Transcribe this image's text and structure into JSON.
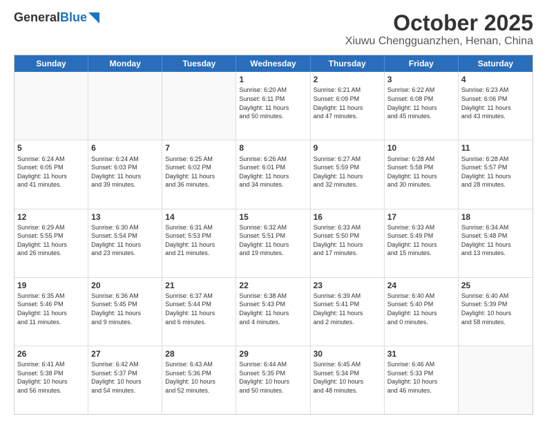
{
  "logo": {
    "general": "General",
    "blue": "Blue"
  },
  "title": "October 2025",
  "subtitle": "Xiuwu Chengguanzhen, Henan, China",
  "header_days": [
    "Sunday",
    "Monday",
    "Tuesday",
    "Wednesday",
    "Thursday",
    "Friday",
    "Saturday"
  ],
  "weeks": [
    [
      {
        "day": "",
        "lines": []
      },
      {
        "day": "",
        "lines": []
      },
      {
        "day": "",
        "lines": []
      },
      {
        "day": "1",
        "lines": [
          "Sunrise: 6:20 AM",
          "Sunset: 6:11 PM",
          "Daylight: 11 hours",
          "and 50 minutes."
        ]
      },
      {
        "day": "2",
        "lines": [
          "Sunrise: 6:21 AM",
          "Sunset: 6:09 PM",
          "Daylight: 11 hours",
          "and 47 minutes."
        ]
      },
      {
        "day": "3",
        "lines": [
          "Sunrise: 6:22 AM",
          "Sunset: 6:08 PM",
          "Daylight: 11 hours",
          "and 45 minutes."
        ]
      },
      {
        "day": "4",
        "lines": [
          "Sunrise: 6:23 AM",
          "Sunset: 6:06 PM",
          "Daylight: 11 hours",
          "and 43 minutes."
        ]
      }
    ],
    [
      {
        "day": "5",
        "lines": [
          "Sunrise: 6:24 AM",
          "Sunset: 6:05 PM",
          "Daylight: 11 hours",
          "and 41 minutes."
        ]
      },
      {
        "day": "6",
        "lines": [
          "Sunrise: 6:24 AM",
          "Sunset: 6:03 PM",
          "Daylight: 11 hours",
          "and 39 minutes."
        ]
      },
      {
        "day": "7",
        "lines": [
          "Sunrise: 6:25 AM",
          "Sunset: 6:02 PM",
          "Daylight: 11 hours",
          "and 36 minutes."
        ]
      },
      {
        "day": "8",
        "lines": [
          "Sunrise: 6:26 AM",
          "Sunset: 6:01 PM",
          "Daylight: 11 hours",
          "and 34 minutes."
        ]
      },
      {
        "day": "9",
        "lines": [
          "Sunrise: 6:27 AM",
          "Sunset: 5:59 PM",
          "Daylight: 11 hours",
          "and 32 minutes."
        ]
      },
      {
        "day": "10",
        "lines": [
          "Sunrise: 6:28 AM",
          "Sunset: 5:58 PM",
          "Daylight: 11 hours",
          "and 30 minutes."
        ]
      },
      {
        "day": "11",
        "lines": [
          "Sunrise: 6:28 AM",
          "Sunset: 5:57 PM",
          "Daylight: 11 hours",
          "and 28 minutes."
        ]
      }
    ],
    [
      {
        "day": "12",
        "lines": [
          "Sunrise: 6:29 AM",
          "Sunset: 5:55 PM",
          "Daylight: 11 hours",
          "and 26 minutes."
        ]
      },
      {
        "day": "13",
        "lines": [
          "Sunrise: 6:30 AM",
          "Sunset: 5:54 PM",
          "Daylight: 11 hours",
          "and 23 minutes."
        ]
      },
      {
        "day": "14",
        "lines": [
          "Sunrise: 6:31 AM",
          "Sunset: 5:53 PM",
          "Daylight: 11 hours",
          "and 21 minutes."
        ]
      },
      {
        "day": "15",
        "lines": [
          "Sunrise: 6:32 AM",
          "Sunset: 5:51 PM",
          "Daylight: 11 hours",
          "and 19 minutes."
        ]
      },
      {
        "day": "16",
        "lines": [
          "Sunrise: 6:33 AM",
          "Sunset: 5:50 PM",
          "Daylight: 11 hours",
          "and 17 minutes."
        ]
      },
      {
        "day": "17",
        "lines": [
          "Sunrise: 6:33 AM",
          "Sunset: 5:49 PM",
          "Daylight: 11 hours",
          "and 15 minutes."
        ]
      },
      {
        "day": "18",
        "lines": [
          "Sunrise: 6:34 AM",
          "Sunset: 5:48 PM",
          "Daylight: 11 hours",
          "and 13 minutes."
        ]
      }
    ],
    [
      {
        "day": "19",
        "lines": [
          "Sunrise: 6:35 AM",
          "Sunset: 5:46 PM",
          "Daylight: 11 hours",
          "and 11 minutes."
        ]
      },
      {
        "day": "20",
        "lines": [
          "Sunrise: 6:36 AM",
          "Sunset: 5:45 PM",
          "Daylight: 11 hours",
          "and 9 minutes."
        ]
      },
      {
        "day": "21",
        "lines": [
          "Sunrise: 6:37 AM",
          "Sunset: 5:44 PM",
          "Daylight: 11 hours",
          "and 6 minutes."
        ]
      },
      {
        "day": "22",
        "lines": [
          "Sunrise: 6:38 AM",
          "Sunset: 5:43 PM",
          "Daylight: 11 hours",
          "and 4 minutes."
        ]
      },
      {
        "day": "23",
        "lines": [
          "Sunrise: 6:39 AM",
          "Sunset: 5:41 PM",
          "Daylight: 11 hours",
          "and 2 minutes."
        ]
      },
      {
        "day": "24",
        "lines": [
          "Sunrise: 6:40 AM",
          "Sunset: 5:40 PM",
          "Daylight: 11 hours",
          "and 0 minutes."
        ]
      },
      {
        "day": "25",
        "lines": [
          "Sunrise: 6:40 AM",
          "Sunset: 5:39 PM",
          "Daylight: 10 hours",
          "and 58 minutes."
        ]
      }
    ],
    [
      {
        "day": "26",
        "lines": [
          "Sunrise: 6:41 AM",
          "Sunset: 5:38 PM",
          "Daylight: 10 hours",
          "and 56 minutes."
        ]
      },
      {
        "day": "27",
        "lines": [
          "Sunrise: 6:42 AM",
          "Sunset: 5:37 PM",
          "Daylight: 10 hours",
          "and 54 minutes."
        ]
      },
      {
        "day": "28",
        "lines": [
          "Sunrise: 6:43 AM",
          "Sunset: 5:36 PM",
          "Daylight: 10 hours",
          "and 52 minutes."
        ]
      },
      {
        "day": "29",
        "lines": [
          "Sunrise: 6:44 AM",
          "Sunset: 5:35 PM",
          "Daylight: 10 hours",
          "and 50 minutes."
        ]
      },
      {
        "day": "30",
        "lines": [
          "Sunrise: 6:45 AM",
          "Sunset: 5:34 PM",
          "Daylight: 10 hours",
          "and 48 minutes."
        ]
      },
      {
        "day": "31",
        "lines": [
          "Sunrise: 6:46 AM",
          "Sunset: 5:33 PM",
          "Daylight: 10 hours",
          "and 46 minutes."
        ]
      },
      {
        "day": "",
        "lines": []
      }
    ]
  ]
}
